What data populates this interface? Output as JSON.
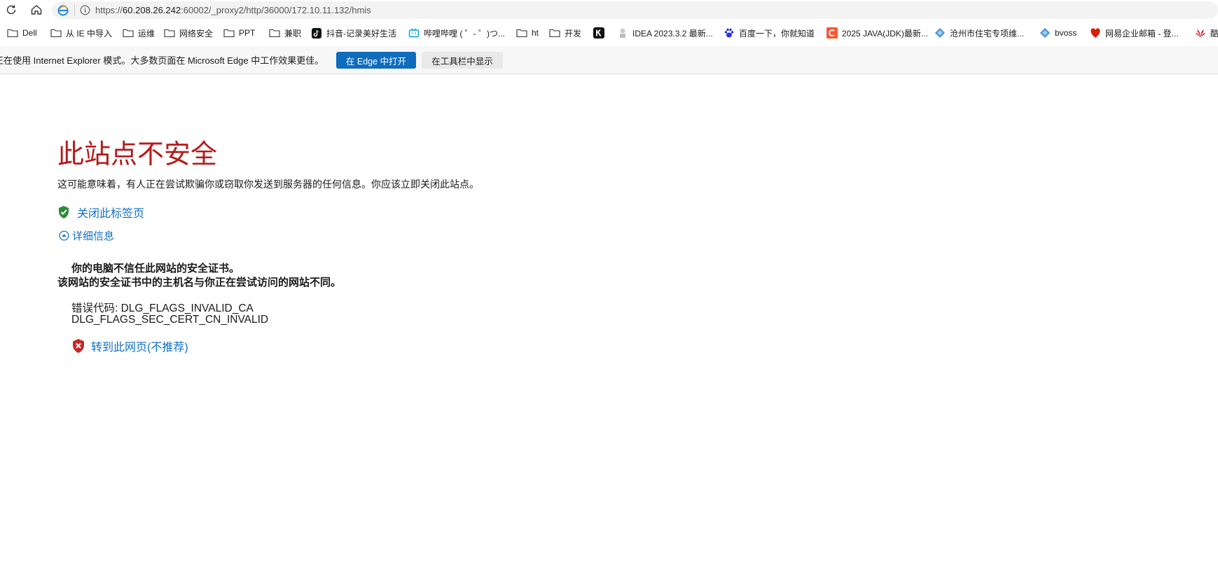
{
  "browser": {
    "url_prefix": "https://",
    "url_host": "60.208.26.242",
    "url_rest": ":60002/_proxy2/http/36000/172.10.11.132/hmis",
    "nav_icons": [
      "refresh-icon",
      "home-icon",
      "ie-mode-icon",
      "info-icon"
    ]
  },
  "bookmarks": [
    {
      "label": "Dell",
      "icon": "folder-icon"
    },
    {
      "label": "从 IE 中导入",
      "icon": "folder-icon"
    },
    {
      "label": "运维",
      "icon": "folder-icon"
    },
    {
      "label": "网络安全",
      "icon": "folder-icon"
    },
    {
      "label": "PPT",
      "icon": "folder-icon"
    },
    {
      "label": "兼职",
      "icon": "folder-icon"
    },
    {
      "label": "抖音-记录美好生活",
      "icon": "douyin-icon"
    },
    {
      "label": "哔哩哔哩 ( ゜- ゜)つ...",
      "icon": "bilibili-icon"
    },
    {
      "label": "ht",
      "icon": "folder-icon"
    },
    {
      "label": "开发",
      "icon": "folder-icon"
    },
    {
      "label": "",
      "icon": "k-icon"
    },
    {
      "label": "IDEA 2023.3.2 最新...",
      "icon": "idea-icon"
    },
    {
      "label": "百度一下，你就知道",
      "icon": "baidu-icon"
    },
    {
      "label": "2025 JAVA(JDK)最新...",
      "icon": "c-icon"
    },
    {
      "label": "沧州市住宅专项维...",
      "icon": "diamond-icon"
    },
    {
      "label": "bvoss",
      "icon": "diamond-icon"
    },
    {
      "label": "网易企业邮箱 - 登...",
      "icon": "netease-icon"
    },
    {
      "label": "酷",
      "icon": "huawei-icon"
    }
  ],
  "iebar": {
    "message": "正在使用 Internet Explorer 模式。大多数页面在 Microsoft Edge 中工作效果更佳。",
    "open_in_edge": "在 Edge 中打开",
    "show_in_toolbar": "在工具栏中显示"
  },
  "error": {
    "title": "此站点不安全",
    "description": "这可能意味着，有人正在尝试欺骗你或窃取你发送到服务器的任何信息。你应该立即关闭此站点。",
    "close_tab": "关闭此标签页",
    "details": "详细信息",
    "cert_untrusted": "你的电脑不信任此网站的安全证书。",
    "cert_name_mismatch": "该网站的安全证书中的主机名与你正在尝试访问的网站不同。",
    "error_code_line1": "错误代码: DLG_FLAGS_INVALID_CA",
    "error_code_line2": "DLG_FLAGS_SEC_CERT_CN_INVALID",
    "continue_link": "转到此网页(不推荐)"
  },
  "colors": {
    "title_red": "#b31b1b",
    "link_blue": "#1070c8",
    "primary_button": "#0f6cbd"
  }
}
